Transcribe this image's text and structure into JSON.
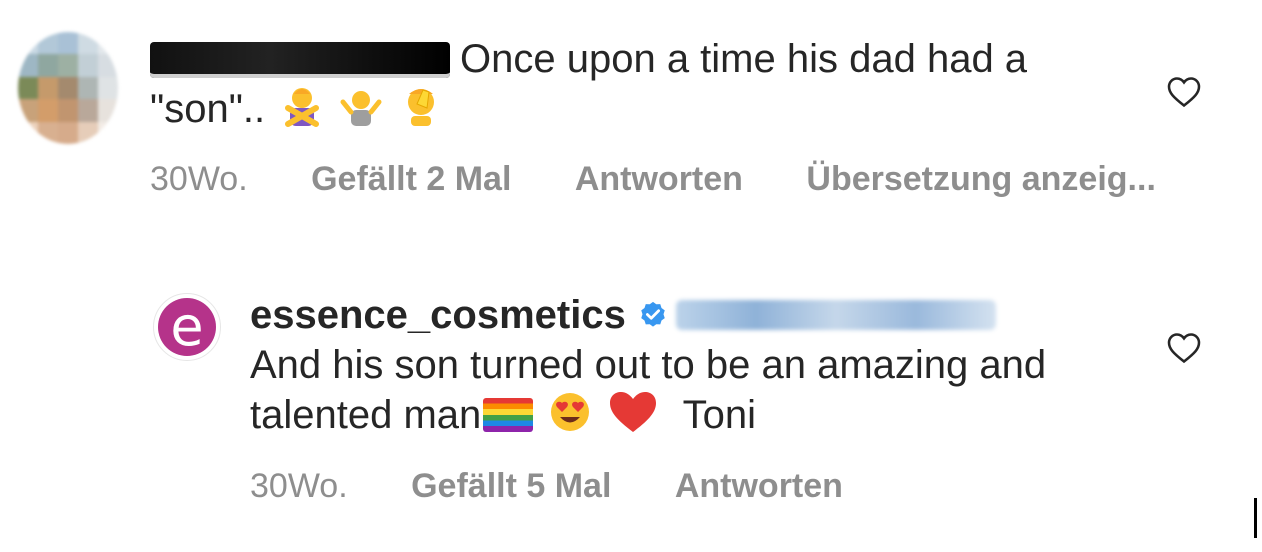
{
  "comment1": {
    "text": "Once upon a time his dad had a \"son\"..",
    "meta": {
      "time": "30Wo.",
      "likes": "Gefällt 2 Mal",
      "reply": "Antworten",
      "translate": "Übersetzung anzeig..."
    }
  },
  "comment2": {
    "username": "essence_cosmetics",
    "text_part1": "And his son turned out to be an amazing and talented man",
    "text_sign": "Toni",
    "meta": {
      "time": "30Wo.",
      "likes": "Gefällt 5 Mal",
      "reply": "Antworten"
    }
  },
  "icons": {
    "like": "heart-outline-icon",
    "verified": "verified-badge-icon",
    "brand_logo": "essence-logo-icon"
  },
  "colors": {
    "text": "#262626",
    "meta": "#8e8e8e",
    "verified": "#3897f0",
    "brand": "#b5338a"
  }
}
